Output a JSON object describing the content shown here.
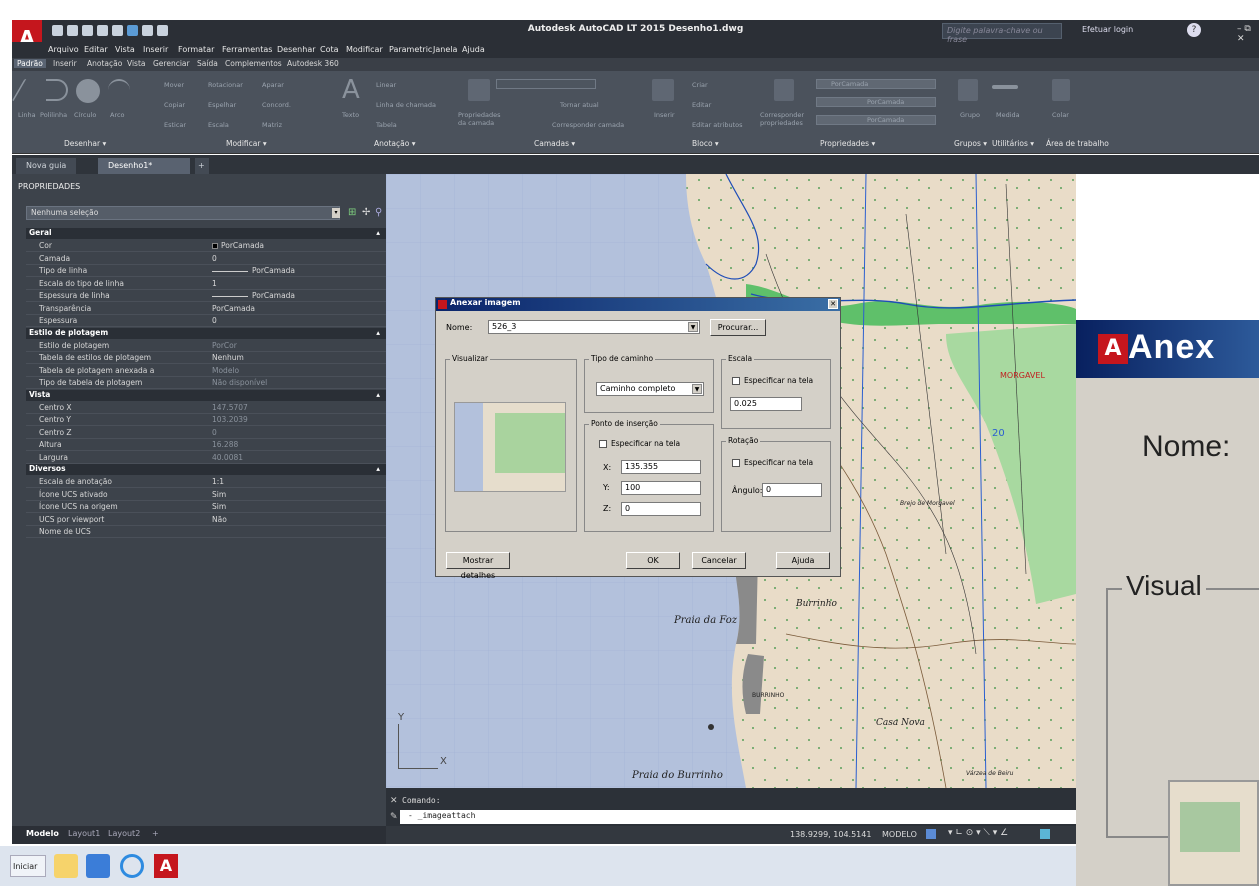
{
  "window": {
    "title": "Autodesk AutoCAD LT 2015   Desenho1.dwg",
    "search_placeholder": "Digite palavra-chave ou frase",
    "login": "Efetuar login"
  },
  "menu": [
    "Arquivo",
    "Editar",
    "Vista",
    "Inserir",
    "Formatar",
    "Ferramentas",
    "Desenhar",
    "Cota",
    "Modificar",
    "Parametric",
    "Janela",
    "Ajuda"
  ],
  "ribbon_tabs": [
    "Padrão",
    "Inserir",
    "Anotação",
    "Vista",
    "Gerenciar",
    "Saída",
    "Complementos",
    "Autodesk 360"
  ],
  "ribbon_panels": {
    "desenhar": "Desenhar ▾",
    "modificar": "Modificar ▾",
    "anotacao": "Anotação ▾",
    "camadas": "Camadas ▾",
    "bloco": "Bloco ▾",
    "propriedades": "Propriedades ▾",
    "grupos": "Grupos ▾",
    "utilitarios": "Utilitários ▾",
    "area": "Área de trabalho"
  },
  "ribbon_tools": {
    "linha": "Linha",
    "polilinha": "Polilinha",
    "circulo": "Círculo",
    "arco": "Arco",
    "mover": "Mover",
    "rotacionar": "Rotacionar",
    "aparar": "Aparar",
    "copiar": "Copiar",
    "espelhar": "Espelhar",
    "concordancia": "Concord.",
    "esticar": "Esticar",
    "escala": "Escala",
    "matriz": "Matriz",
    "texto": "Texto",
    "linear": "Linear",
    "linha_chamada": "Linha de chamada",
    "tabela": "Tabela",
    "prop_camada": "Propriedades da camada",
    "tornar_atual": "Tornar atual",
    "corresponder_camada": "Corresponder camada",
    "inserir": "Inserir",
    "criar": "Criar",
    "editar": "Editar",
    "editar_atributos": "Editar atributos",
    "corresponder_prop": "Corresponder propriedades",
    "porcamada1": "PorCamada",
    "porcamada2": "PorCamada",
    "porcamada3": "PorCamada",
    "grupo": "Grupo",
    "medida": "Medida",
    "colar": "Colar"
  },
  "doc_tabs": {
    "nova": "Nova guia",
    "desenho": "Desenho1*",
    "plus": "+"
  },
  "properties": {
    "title": "PROPRIEDADES",
    "selection": "Nenhuma seleção",
    "sections": {
      "geral": "Geral",
      "plotagem": "Estilo de plotagem",
      "vista": "Vista",
      "diversos": "Diversos"
    },
    "geral": [
      {
        "k": "Cor",
        "v": "PorCamada"
      },
      {
        "k": "Camada",
        "v": "0"
      },
      {
        "k": "Tipo de linha",
        "v": "PorCamada"
      },
      {
        "k": "Escala do tipo de linha",
        "v": "1"
      },
      {
        "k": "Espessura de linha",
        "v": "PorCamada"
      },
      {
        "k": "Transparência",
        "v": "PorCamada"
      },
      {
        "k": "Espessura",
        "v": "0"
      }
    ],
    "plotagem": [
      {
        "k": "Estilo de plotagem",
        "v": "PorCor"
      },
      {
        "k": "Tabela de estilos de plotagem",
        "v": "Nenhum"
      },
      {
        "k": "Tabela de plotagem anexada a",
        "v": "Modelo"
      },
      {
        "k": "Tipo de tabela de plotagem",
        "v": "Não disponível"
      }
    ],
    "vista": [
      {
        "k": "Centro X",
        "v": "147.5707"
      },
      {
        "k": "Centro Y",
        "v": "103.2039"
      },
      {
        "k": "Centro Z",
        "v": "0"
      },
      {
        "k": "Altura",
        "v": "16.288"
      },
      {
        "k": "Largura",
        "v": "40.0081"
      }
    ],
    "diversos": [
      {
        "k": "Escala de anotação",
        "v": "1:1"
      },
      {
        "k": "Ícone UCS ativado",
        "v": "Sim"
      },
      {
        "k": "Ícone UCS na origem",
        "v": "Sim"
      },
      {
        "k": "UCS por viewport",
        "v": "Não"
      },
      {
        "k": "Nome de UCS",
        "v": ""
      }
    ]
  },
  "layout_tabs": [
    "Modelo",
    "Layout1",
    "Layout2"
  ],
  "map_labels": {
    "praia_foz": "Praia da Foz",
    "praia_burrinho": "Praia do Burrinho",
    "burrinho": "Burrinho",
    "casa_nova": "Casa Nova",
    "morgavel": "MORGAVEL",
    "brejo": "Brejo de Morgavel",
    "burrinho_small": "BURRINHO",
    "varzea": "Várzea de Beiru",
    "num20": "20"
  },
  "command": {
    "prompt": "Comando:",
    "current": "- _imageattach"
  },
  "status": {
    "coords": "138.9299, 104.5141",
    "mode": "MODELO"
  },
  "taskbar": {
    "start": "Iniciar"
  },
  "dialog": {
    "title": "Anexar imagem",
    "nome_label": "Nome:",
    "nome_value": "526_3",
    "procurar": "Procurar...",
    "visualizar": "Visualizar",
    "tipo_caminho": "Tipo de caminho",
    "caminho_value": "Caminho completo",
    "escala": "Escala",
    "escala_check": "Especificar na tela",
    "escala_value": "0.025",
    "ponto_insercao": "Ponto de inserção",
    "ponto_check": "Especificar na tela",
    "x_label": "X:",
    "x_value": "135.355",
    "y_label": "Y:",
    "y_value": "100",
    "z_label": "Z:",
    "z_value": "0",
    "rotacao": "Rotação",
    "rotacao_check": "Especificar na tela",
    "angulo_label": "Ângulo:",
    "angulo_value": "0",
    "detalhes": "Mostrar detalhes",
    "ok": "OK",
    "cancelar": "Cancelar",
    "ajuda": "Ajuda"
  },
  "zoom": {
    "title": "Anex",
    "nome": "Nome:",
    "visual": "Visual"
  },
  "colors": {
    "map_bg": "#b3c1dc",
    "land": "#e8d9c4",
    "green": "#8ecf8a",
    "ui_dark": "#3d434b",
    "accent": "#c5161d"
  }
}
